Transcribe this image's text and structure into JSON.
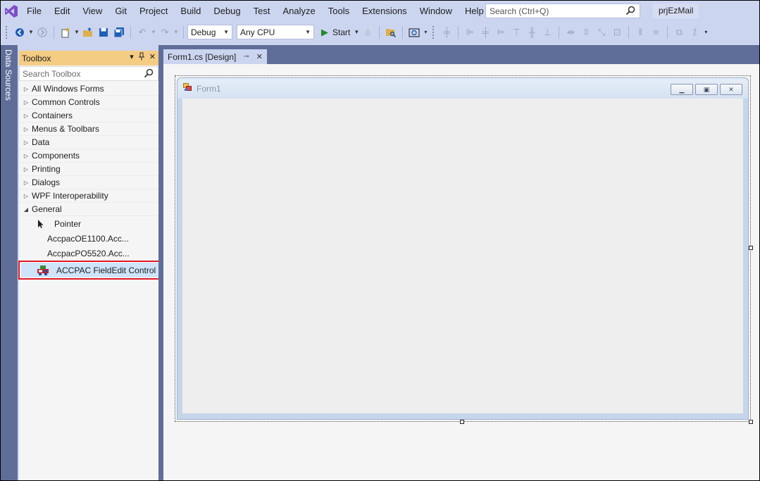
{
  "menu": {
    "items": [
      "File",
      "Edit",
      "View",
      "Git",
      "Project",
      "Build",
      "Debug",
      "Test",
      "Analyze",
      "Tools",
      "Extensions",
      "Window",
      "Help"
    ],
    "search_placeholder": "Search (Ctrl+Q)",
    "project_name": "prjEzMail"
  },
  "toolbar": {
    "config": "Debug",
    "platform": "Any CPU",
    "start_label": "Start"
  },
  "side_strip": {
    "label": "Data Sources"
  },
  "toolbox": {
    "title": "Toolbox",
    "search_placeholder": "Search Toolbox",
    "categories": [
      "All Windows Forms",
      "Common Controls",
      "Containers",
      "Menus & Toolbars",
      "Data",
      "Components",
      "Printing",
      "Dialogs",
      "WPF Interoperability"
    ],
    "general": {
      "label": "General",
      "items": [
        {
          "label": "Pointer",
          "icon": "pointer-icon"
        },
        {
          "label": "AccpacOE1100.Acc...",
          "icon": ""
        },
        {
          "label": "AccpacPO5520.Acc...",
          "icon": ""
        },
        {
          "label": "ACCPAC FieldEdit Control",
          "icon": "accpac-control-icon",
          "selected": true
        }
      ]
    }
  },
  "document": {
    "tab_label": "Form1.cs [Design]",
    "form_title": "Form1"
  },
  "colors": {
    "chrome": "#ccd5f0",
    "panel_dark": "#5f6e99",
    "toolbox_header": "#f5cc84",
    "selection_border": "#e0161f",
    "selection_fill": "#cfe4fa"
  }
}
